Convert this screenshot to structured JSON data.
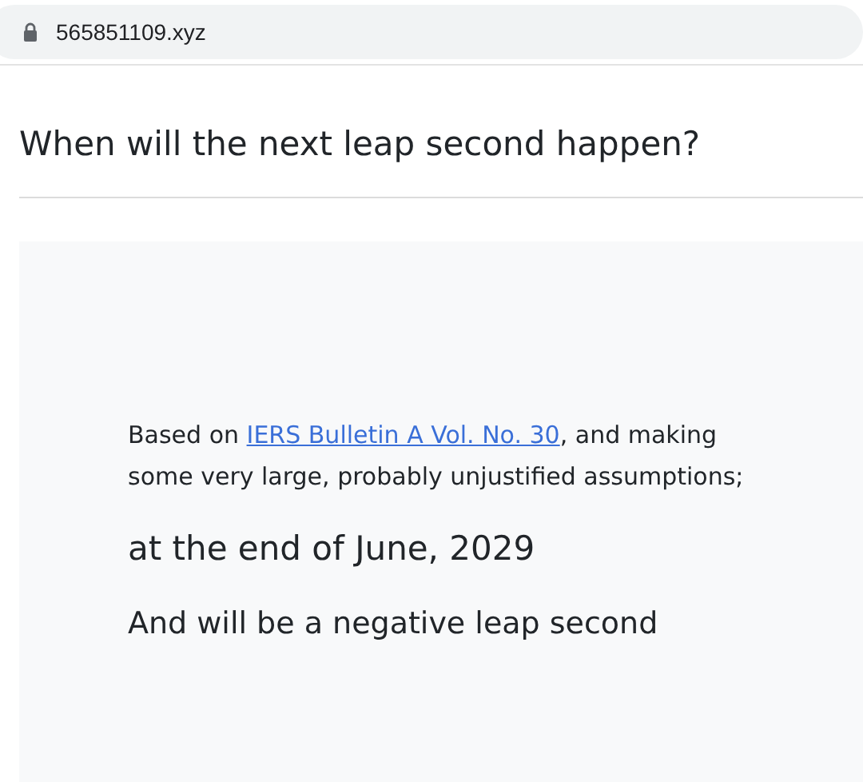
{
  "address_bar": {
    "url": "565851109.xyz"
  },
  "heading": "When will the next leap second happen?",
  "card": {
    "intro_before": "Based on ",
    "intro_link": "IERS Bulletin A Vol. No. 30",
    "intro_after": ", and making some very large, probably unjustified assumptions;",
    "answer": "at the end of June, 2029",
    "note": "And will be a negative leap second"
  }
}
